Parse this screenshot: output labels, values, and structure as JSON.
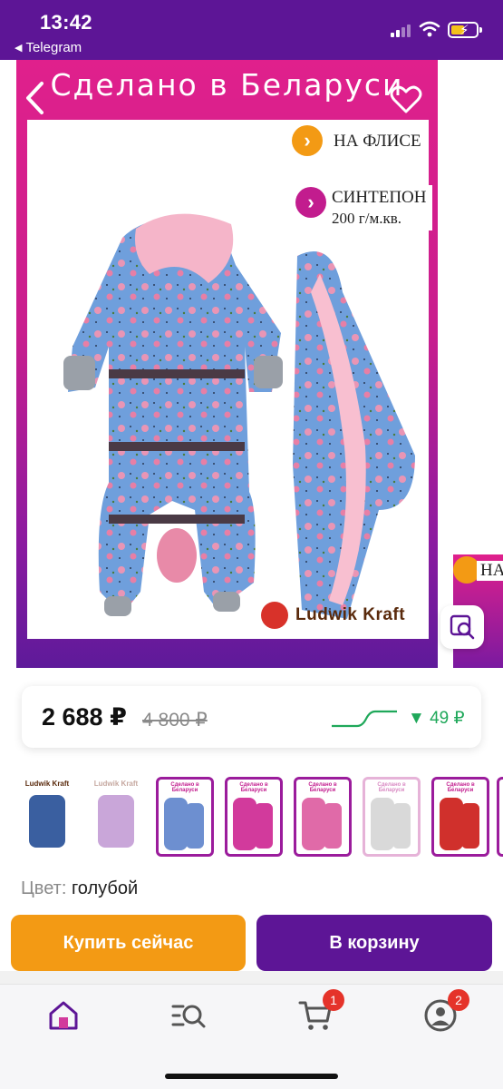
{
  "status_bar": {
    "time": "13:42",
    "back_app_label": "Telegram"
  },
  "product_image": {
    "headline": "Сделано в Беларуси",
    "badges": [
      {
        "text": "НА ФЛИСЕ",
        "color": "#f39a14"
      },
      {
        "text": "СИНТЕПОН",
        "subtext": "200 г/м.кв.",
        "color": "#c21c8e"
      }
    ],
    "brand_name": "Ludwik Kraft",
    "next_image_badge_text": "НА"
  },
  "price": {
    "current": "2 688 ₽",
    "old": "4 800 ₽",
    "drop": "▼ 49 ₽"
  },
  "thumbnails": [
    {
      "title": "Ludwik Kraft",
      "kind": "brand",
      "color": "#3a5fa0"
    },
    {
      "title": "Ludwik Kraft",
      "kind": "brand",
      "color": "#c9a6d9"
    },
    {
      "title": "Сделано в Беларуси",
      "kind": "framed",
      "color": "#6d8fd0"
    },
    {
      "title": "Сделано в Беларуси",
      "kind": "framed",
      "color": "#d23a9c"
    },
    {
      "title": "Сделано в Беларуси",
      "kind": "framed",
      "color": "#e06aa8"
    },
    {
      "title": "Сделано в Беларуси",
      "kind": "framed",
      "color": "#d9d9d9"
    },
    {
      "title": "Сделано в Беларуси",
      "kind": "framed",
      "color": "#d0302c"
    }
  ],
  "color_option": {
    "label": "Цвет:",
    "value": "голубой"
  },
  "actions": {
    "buy_now": "Купить сейчас",
    "add_to_cart": "В корзину"
  },
  "tab_bar": {
    "tabs": [
      {
        "name": "home",
        "icon": "home-icon",
        "badge": ""
      },
      {
        "name": "catalog",
        "icon": "catalog-search-icon",
        "badge": ""
      },
      {
        "name": "cart",
        "icon": "cart-icon",
        "badge": "1"
      },
      {
        "name": "profile",
        "icon": "profile-icon",
        "badge": "2"
      }
    ]
  },
  "colors": {
    "brand_purple": "#5d1596",
    "accent_orange": "#f39a14",
    "price_drop_green": "#1fa85a",
    "badge_red": "#e5332a"
  }
}
